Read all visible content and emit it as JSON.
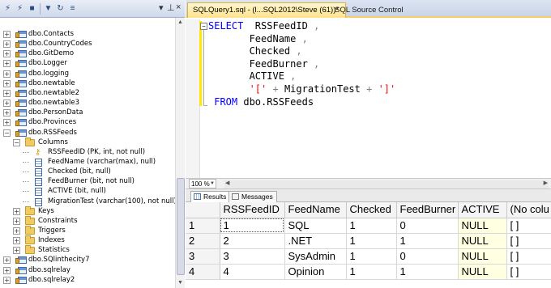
{
  "object_explorer": {
    "toolbar_icons": [
      "connect-icon",
      "disconnect-icon",
      "stop-icon",
      "filter-icon",
      "refresh-icon",
      "collapse-icon"
    ],
    "pin_glyphs": [
      "▾",
      "⊥",
      "×"
    ],
    "tree": [
      {
        "label": "dbo.Contacts",
        "type": "table",
        "expander": "+"
      },
      {
        "label": "dbo.CountryCodes",
        "type": "table",
        "expander": "+"
      },
      {
        "label": "dbo.GitDemo",
        "type": "table",
        "expander": "+"
      },
      {
        "label": "dbo.Logger",
        "type": "table",
        "expander": "+"
      },
      {
        "label": "dbo.logging",
        "type": "table",
        "expander": "+"
      },
      {
        "label": "dbo.newtable",
        "type": "table",
        "expander": "+"
      },
      {
        "label": "dbo.newtable2",
        "type": "table",
        "expander": "+"
      },
      {
        "label": "dbo.newtable3",
        "type": "table",
        "expander": "+"
      },
      {
        "label": "dbo.PersonData",
        "type": "table",
        "expander": "+"
      },
      {
        "label": "dbo.Provinces",
        "type": "table",
        "expander": "+"
      },
      {
        "label": "dbo.RSSFeeds",
        "type": "table",
        "expander": "−"
      },
      {
        "label": "Columns",
        "type": "folder",
        "expander": "−"
      },
      {
        "label": "RSSFeedID (PK, int, not null)",
        "type": "key"
      },
      {
        "label": "FeedName (varchar(max), null)",
        "type": "column"
      },
      {
        "label": "Checked (bit, null)",
        "type": "column"
      },
      {
        "label": "FeedBurner (bit, not null)",
        "type": "column"
      },
      {
        "label": "ACTIVE (bit, null)",
        "type": "column"
      },
      {
        "label": "MigrationTest (varchar(100), not null)",
        "type": "column"
      },
      {
        "label": "Keys",
        "type": "folder",
        "expander": "+"
      },
      {
        "label": "Constraints",
        "type": "folder",
        "expander": "+"
      },
      {
        "label": "Triggers",
        "type": "folder",
        "expander": "+"
      },
      {
        "label": "Indexes",
        "type": "folder",
        "expander": "+"
      },
      {
        "label": "Statistics",
        "type": "folder",
        "expander": "+"
      },
      {
        "label": "dbo.SQlinthecity7",
        "type": "table",
        "expander": "+"
      },
      {
        "label": "dbo.sqlrelay",
        "type": "table",
        "expander": "+"
      },
      {
        "label": "dbo.sqlrelay2",
        "type": "table",
        "expander": "+"
      }
    ]
  },
  "tabs": {
    "active": "SQLQuery1.sql - (l...SQL2012\\Steve (61))*",
    "active_close": "×",
    "inactive": "SQL Source Control",
    "inactive_close": "×"
  },
  "editor": {
    "collapse_glyph": "−",
    "lines": [
      [
        {
          "t": "SELECT",
          "c": "kw"
        },
        {
          "t": "  RSSFeedID ",
          "c": "ident"
        },
        {
          "t": ",",
          "c": "op"
        }
      ],
      [
        {
          "t": "       FeedName ",
          "c": "ident"
        },
        {
          "t": ",",
          "c": "op"
        }
      ],
      [
        {
          "t": "       Checked ",
          "c": "ident"
        },
        {
          "t": ",",
          "c": "op"
        }
      ],
      [
        {
          "t": "       FeedBurner ",
          "c": "ident"
        },
        {
          "t": ",",
          "c": "op"
        }
      ],
      [
        {
          "t": "       ACTIVE ",
          "c": "ident"
        },
        {
          "t": ",",
          "c": "op"
        }
      ],
      [
        {
          "t": "       ",
          "c": "ident"
        },
        {
          "t": "'['",
          "c": "str"
        },
        {
          "t": " + ",
          "c": "op"
        },
        {
          "t": "MigrationTest",
          "c": "ident"
        },
        {
          "t": " + ",
          "c": "op"
        },
        {
          "t": "']'",
          "c": "str"
        }
      ],
      [
        {
          "t": " FROM",
          "c": "kw"
        },
        {
          "t": " dbo.RSSFeeds",
          "c": "ident"
        }
      ]
    ]
  },
  "zoom": {
    "value": "100 %"
  },
  "results_tabs": {
    "results": "Results",
    "messages": "Messages"
  },
  "grid": {
    "columns": [
      "",
      "RSSFeedID",
      "FeedName",
      "Checked",
      "FeedBurner",
      "ACTIVE",
      "(No colu"
    ],
    "rows": [
      [
        "1",
        "1",
        "SQL",
        "1",
        "0",
        "NULL",
        "[ ]"
      ],
      [
        "2",
        "2",
        ".NET",
        "1",
        "1",
        "NULL",
        "[ ]"
      ],
      [
        "3",
        "3",
        "SysAdmin",
        "1",
        "0",
        "NULL",
        "[ ]"
      ],
      [
        "4",
        "4",
        "Opinion",
        "1",
        "1",
        "NULL",
        "[ ]"
      ]
    ]
  },
  "colors": {
    "tab_active": "#ffe28a",
    "keyword": "#0000ff",
    "string": "#ff0000",
    "operator": "#808080",
    "null_cell": "#ffffe1",
    "change_bar": "#ffe700"
  }
}
